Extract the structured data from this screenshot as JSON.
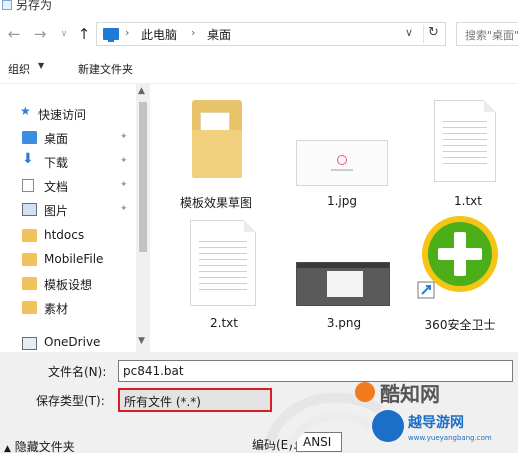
{
  "window": {
    "title": "另存为"
  },
  "address": {
    "segments": [
      "此电脑",
      "桌面"
    ],
    "search_placeholder": "搜索\"桌面\""
  },
  "toolbar": {
    "organize_label": "组织",
    "new_folder_label": "新建文件夹"
  },
  "sidebar": {
    "items": [
      {
        "label": "快速访问",
        "icon": "star-icon"
      },
      {
        "label": "桌面",
        "icon": "desktop-icon",
        "pinned": true
      },
      {
        "label": "下载",
        "icon": "download-icon",
        "pinned": true
      },
      {
        "label": "文档",
        "icon": "document-icon",
        "pinned": true
      },
      {
        "label": "图片",
        "icon": "picture-icon",
        "pinned": true
      },
      {
        "label": "htdocs",
        "icon": "folder-icon"
      },
      {
        "label": "MobileFile",
        "icon": "folder-icon"
      },
      {
        "label": "模板设想",
        "icon": "folder-icon"
      },
      {
        "label": "素材",
        "icon": "folder-icon"
      },
      {
        "label": "OneDrive",
        "icon": "onedrive-icon"
      }
    ]
  },
  "files": [
    {
      "name": "模板效果草图",
      "type": "folder"
    },
    {
      "name": "1.jpg",
      "type": "image"
    },
    {
      "name": "1.txt",
      "type": "text"
    },
    {
      "name": "2.txt",
      "type": "text"
    },
    {
      "name": "3.png",
      "type": "image"
    },
    {
      "name": "360安全卫士",
      "type": "shortcut"
    }
  ],
  "save": {
    "filename_label": "文件名(N):",
    "filename_value": "pc841.bat",
    "filetype_label": "保存类型(T):",
    "filetype_value": "所有文件 (*.*)",
    "hide_folders_label": "隐藏文件夹",
    "encoding_label": "编码(E):",
    "encoding_value": "ANSI"
  },
  "watermark": {
    "text1": "酷知网",
    "text2": "越导游网",
    "url": "www.yueyangbang.com"
  },
  "colors": {
    "accent_blue": "#1e7ad6",
    "highlight_red": "#d71f27",
    "folder_yellow": "#f2c35c",
    "brand_green": "#4caf1a"
  }
}
